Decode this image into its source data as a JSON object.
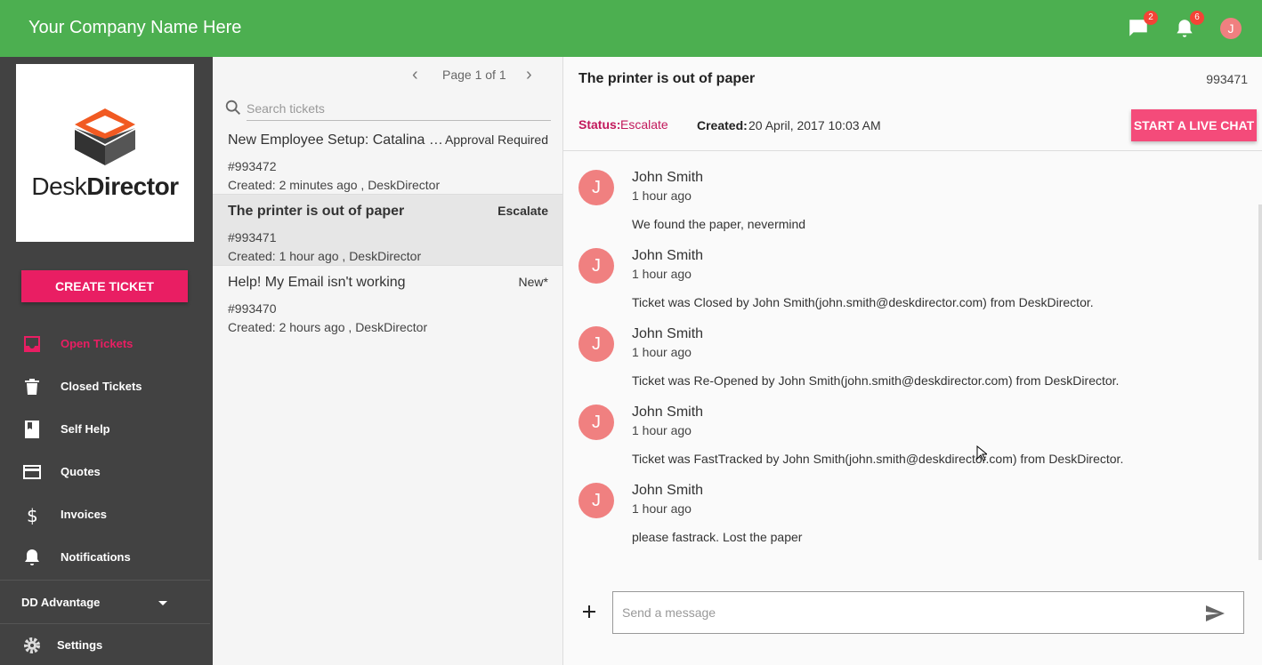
{
  "header": {
    "company": "Your Company Name Here",
    "chat_badge": "2",
    "notif_badge": "6",
    "avatar_initial": "J"
  },
  "sidebar": {
    "logo_prefix": "Desk",
    "logo_suffix": "Director",
    "create_ticket": "CREATE TICKET",
    "items": [
      {
        "label": "Open Tickets",
        "icon": "inbox-icon"
      },
      {
        "label": "Closed Tickets",
        "icon": "trash-icon"
      },
      {
        "label": "Self Help",
        "icon": "book-icon"
      },
      {
        "label": "Quotes",
        "icon": "credit-card-icon"
      },
      {
        "label": "Invoices",
        "icon": "dollar-icon"
      },
      {
        "label": "Notifications",
        "icon": "bell-icon"
      }
    ],
    "advantage": "DD Advantage",
    "settings": "Settings"
  },
  "list": {
    "pager": "Page 1 of 1",
    "search_placeholder": "Search tickets",
    "tickets": [
      {
        "title": "New Employee Setup: Catalina R...",
        "status": "Approval Required",
        "number": "#993472",
        "meta": "Created: 2 minutes ago , DeskDirector"
      },
      {
        "title": "The printer is out of paper",
        "status": "Escalate",
        "number": "#993471",
        "meta": "Created: 1 hour ago , DeskDirector"
      },
      {
        "title": "Help! My Email isn't working",
        "status": "New*",
        "number": "#993470",
        "meta": "Created: 2 hours ago , DeskDirector"
      }
    ]
  },
  "detail": {
    "title": "The printer is out of paper",
    "id": "993471",
    "status_label": "Status:",
    "status_value": "Escalate",
    "created_label": "Created:",
    "created_value": "20 April, 2017 10:03 AM",
    "live_chat": "START A LIVE CHAT",
    "messages": [
      {
        "initial": "J",
        "author": "John Smith",
        "time": "1 hour ago",
        "text": "We found the paper, nevermind"
      },
      {
        "initial": "J",
        "author": "John Smith",
        "time": "1 hour ago",
        "text": "Ticket was Closed by John Smith(john.smith@deskdirector.com) from DeskDirector."
      },
      {
        "initial": "J",
        "author": "John Smith",
        "time": "1 hour ago",
        "text": "Ticket was Re-Opened by John Smith(john.smith@deskdirector.com) from DeskDirector."
      },
      {
        "initial": "J",
        "author": "John Smith",
        "time": "1 hour ago",
        "text": "Ticket was FastTracked by John Smith(john.smith@deskdirector.com) from DeskDirector."
      },
      {
        "initial": "J",
        "author": "John Smith",
        "time": "1 hour ago",
        "text": "please fastrack. Lost the paper"
      }
    ],
    "message_placeholder": "Send a message"
  },
  "colors": {
    "header": "#4caf50",
    "accent": "#e91e63",
    "sidebar": "#424242",
    "avatar": "#f08080"
  }
}
